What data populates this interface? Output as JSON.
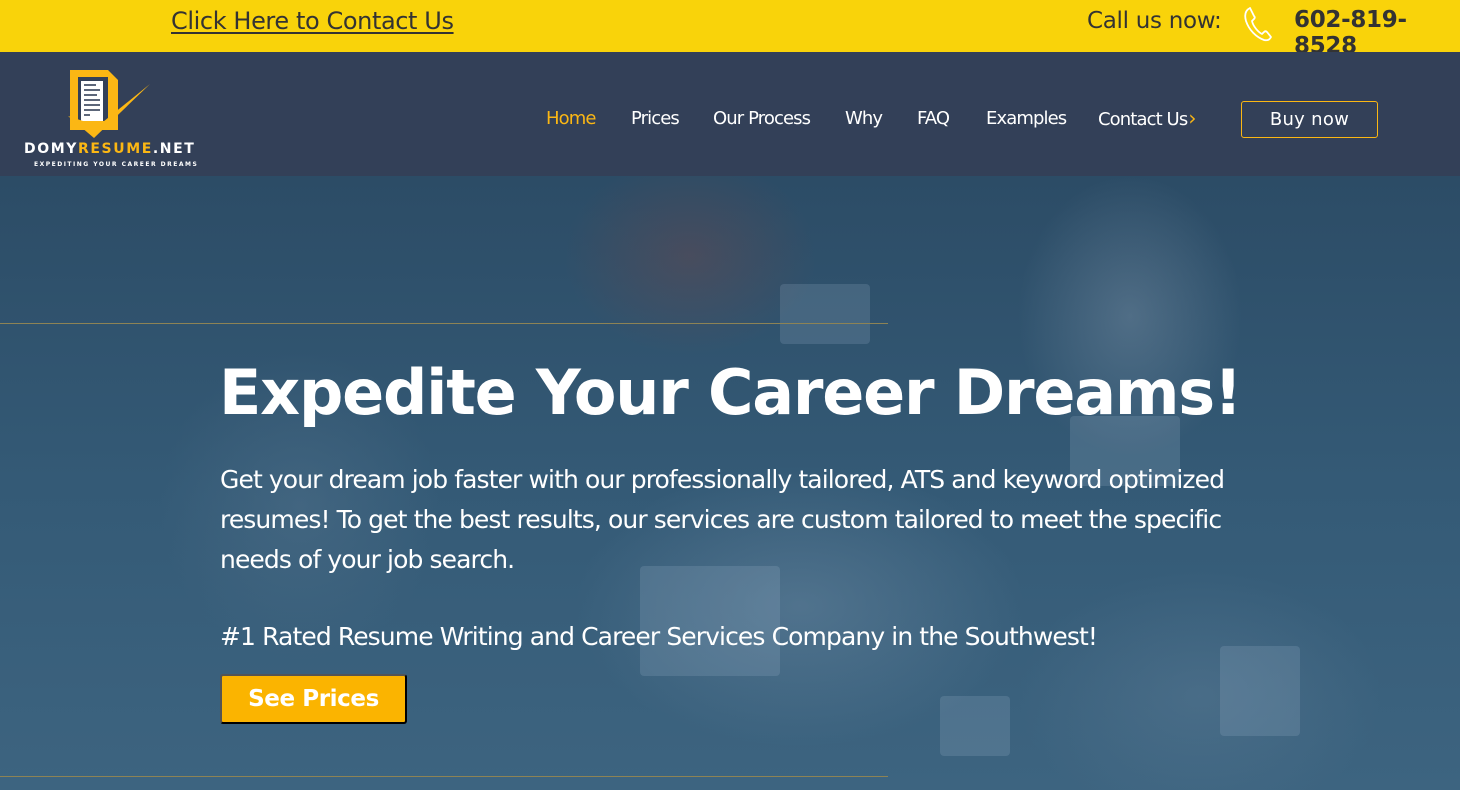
{
  "topbar": {
    "contact_link": "Click Here to Contact Us",
    "call_label": "Call us now:",
    "phone_icon": "phone-icon",
    "phone_number": "602-819-8528",
    "background_color": "#f9d30a"
  },
  "header": {
    "logo": {
      "brand_prefix": "DOMY",
      "brand_accent": "RESUME",
      "brand_suffix": ".NET",
      "tagline": "EXPEDITING YOUR CAREER DREAMS",
      "icon": "resume-checkmark-logo-icon"
    },
    "nav": [
      {
        "label": "Home",
        "active": true
      },
      {
        "label": "Prices",
        "active": false
      },
      {
        "label": "Our Process",
        "active": false
      },
      {
        "label": "Why",
        "active": false
      },
      {
        "label": "FAQ",
        "active": false
      },
      {
        "label": "Examples",
        "active": false
      },
      {
        "label": "Contact Us",
        "active": false,
        "icon": "chevron-right-icon"
      }
    ],
    "nav_arrow": "›",
    "buy_button": "Buy now",
    "background_color": "#334058",
    "accent_color": "#fbb714"
  },
  "hero": {
    "title": "Expedite Your Career Dreams!",
    "description": "Get your dream job faster with our professionally tailored, ATS and keyword optimized\nresumes!  To get the best results, our services are custom tailored to meet the specific\nneeds of your job search.",
    "rating": "#1 Rated Resume Writing and Career Services Company in the Southwest!",
    "cta_button": "See Prices",
    "cta_color": "#fbb400",
    "divider_color": "#8d8355"
  }
}
